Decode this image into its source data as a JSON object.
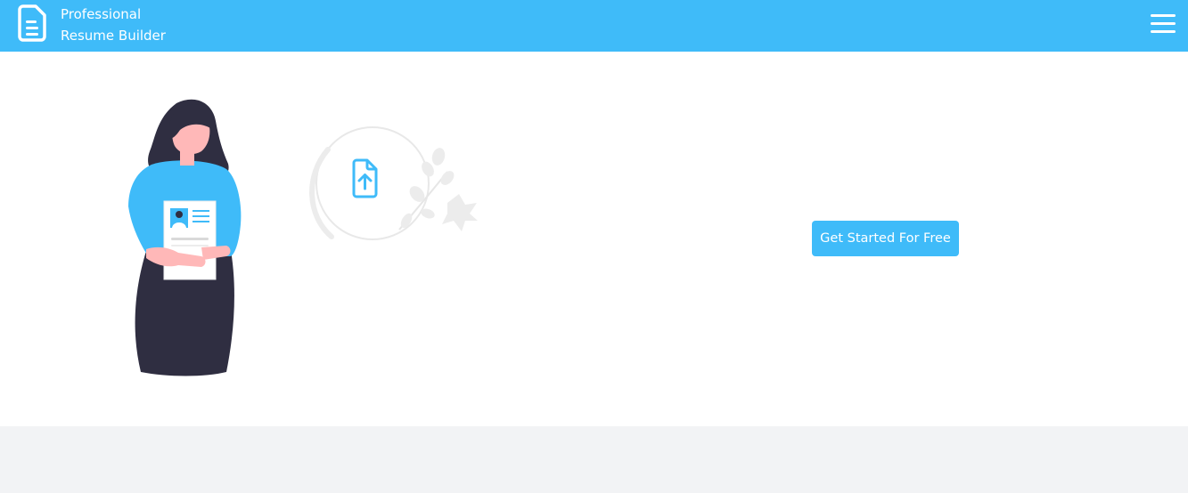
{
  "header": {
    "brand_line1": "Professional",
    "brand_line2": "Resume Builder",
    "logo_icon": "document-icon",
    "menu_icon": "hamburger-menu-icon",
    "background_color": "#3fbbf9"
  },
  "hero": {
    "cta_label": "Get Started For Free",
    "illustration": "woman-holding-resume-illustration",
    "upload_icon": "file-upload-icon",
    "accent_color": "#3fbbf9"
  },
  "colors": {
    "primary": "#3fbbf9",
    "dark": "#2f2e41",
    "skin": "#ffb8b8",
    "footer_bg": "#f2f3f5"
  }
}
